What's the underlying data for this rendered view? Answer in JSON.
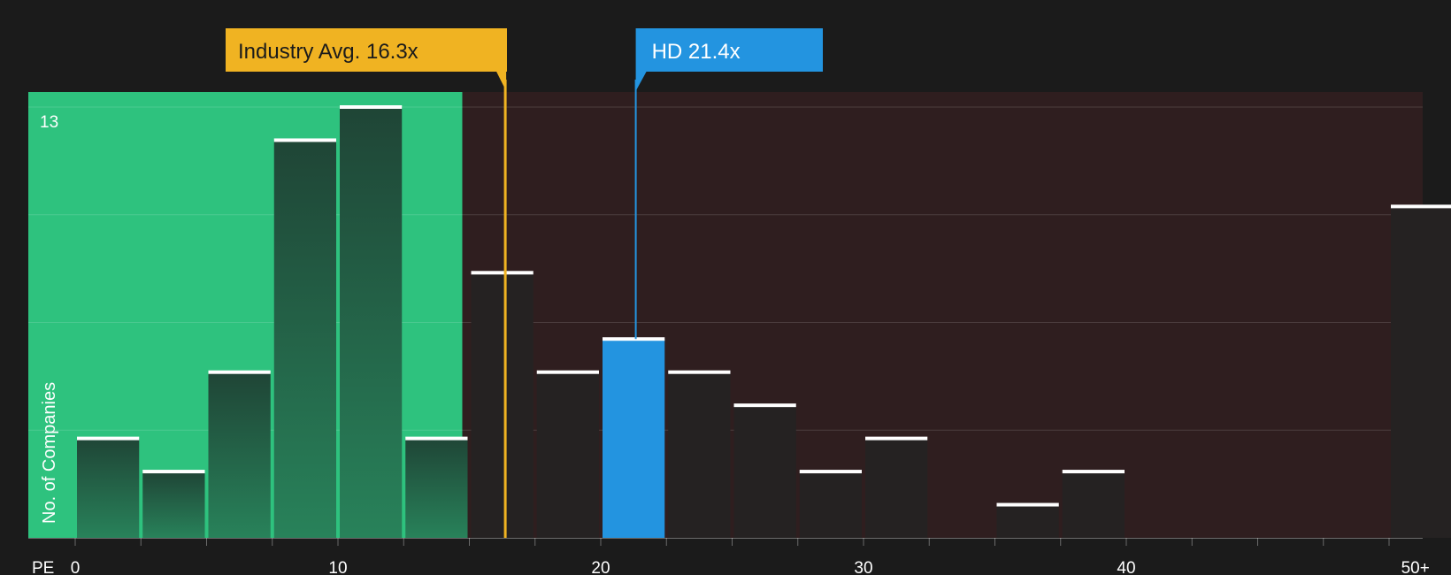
{
  "chart_data": {
    "type": "bar",
    "title": "",
    "xlabel": "PE",
    "ylabel": "No. of Companies",
    "ylim": [
      0,
      13
    ],
    "y_tick_labels": [
      "13"
    ],
    "x_tick_labels": [
      {
        "value": 0,
        "label": "0"
      },
      {
        "value": 10,
        "label": "10"
      },
      {
        "value": 20,
        "label": "20"
      },
      {
        "value": 30,
        "label": "30"
      },
      {
        "value": 40,
        "label": "40"
      },
      {
        "value": 51,
        "label": "50+"
      }
    ],
    "bins": [
      {
        "from": 0,
        "to": 2.5,
        "count": 3
      },
      {
        "from": 2.5,
        "to": 5,
        "count": 2
      },
      {
        "from": 5,
        "to": 7.5,
        "count": 5
      },
      {
        "from": 7.5,
        "to": 10,
        "count": 12
      },
      {
        "from": 10,
        "to": 12.5,
        "count": 13
      },
      {
        "from": 12.5,
        "to": 15,
        "count": 3
      },
      {
        "from": 15,
        "to": 17.5,
        "count": 8
      },
      {
        "from": 17.5,
        "to": 20,
        "count": 5
      },
      {
        "from": 20,
        "to": 22.5,
        "count": 6
      },
      {
        "from": 22.5,
        "to": 25,
        "count": 5
      },
      {
        "from": 25,
        "to": 27.5,
        "count": 4
      },
      {
        "from": 27.5,
        "to": 30,
        "count": 2
      },
      {
        "from": 30,
        "to": 32.5,
        "count": 3
      },
      {
        "from": 35,
        "to": 37.5,
        "count": 1
      },
      {
        "from": 37.5,
        "to": 40,
        "count": 2
      },
      {
        "from": 50,
        "to": 52.5,
        "count": 10
      }
    ],
    "highlight_bin_from": 20,
    "industry_avg": {
      "value": 16.3,
      "label": "Industry Avg. 16.3x"
    },
    "company": {
      "value": 21.4,
      "label": "HD 21.4x"
    },
    "grid": true,
    "colors": {
      "background": "#1b1b1b",
      "below_avg_zone": "#2ec27e",
      "above_avg_zone": "#2f1e1f",
      "bar_default": "#252222",
      "bar_below_avg_top": "#1f4a38",
      "highlight_bar": "#2394e0",
      "avg_marker": "#f0b322",
      "company_marker": "#2394e0",
      "bar_cap": "#ffffff",
      "axis_text": "#ffffff"
    }
  }
}
